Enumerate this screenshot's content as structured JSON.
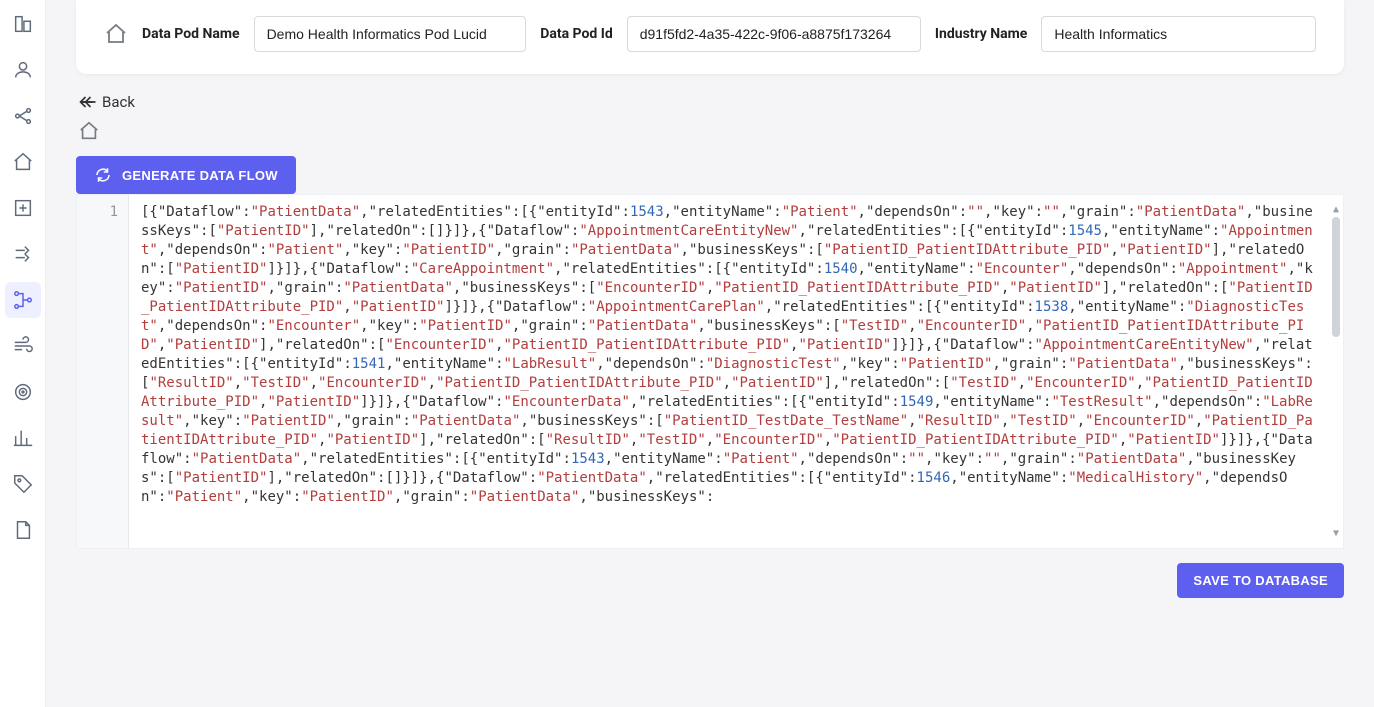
{
  "header": {
    "podNameLabel": "Data Pod Name",
    "podNameValue": "Demo Health Informatics Pod Lucid",
    "podIdLabel": "Data Pod Id",
    "podIdValue": "d91f5fd2-4a35-422c-9f06-a8875f173264",
    "industryLabel": "Industry Name",
    "industryValue": "Health Informatics"
  },
  "back": {
    "label": "Back"
  },
  "buttons": {
    "generate": "GENERATE DATA FLOW",
    "save": "SAVE TO DATABASE"
  },
  "editor": {
    "lineNumber": "1"
  },
  "sidebar_icons": [
    "org-icon",
    "user-icon",
    "nodes-icon",
    "home-icon",
    "export-icon",
    "flow-icon",
    "graph-icon",
    "wind-icon",
    "target-icon",
    "analytics-icon",
    "tag-icon",
    "doc-icon"
  ],
  "code_tokens": [
    [
      "p",
      "[{"
    ],
    [
      "k",
      "\"Dataflow\""
    ],
    [
      "p",
      ":"
    ],
    [
      "s",
      "\"PatientData\""
    ],
    [
      "p",
      ","
    ],
    [
      "k",
      "\"relatedEntities\""
    ],
    [
      "p",
      ":[{"
    ],
    [
      "k",
      "\"entityId\""
    ],
    [
      "p",
      ":"
    ],
    [
      "n",
      "1543"
    ],
    [
      "p",
      ","
    ],
    [
      "k",
      "\"entityName\""
    ],
    [
      "p",
      ":"
    ],
    [
      "s",
      "\"Patient\""
    ],
    [
      "p",
      ","
    ],
    [
      "k",
      "\"dependsOn\""
    ],
    [
      "p",
      ":"
    ],
    [
      "s",
      "\"\""
    ],
    [
      "p",
      ","
    ],
    [
      "k",
      "\"key\""
    ],
    [
      "p",
      ":"
    ],
    [
      "s",
      "\"\""
    ],
    [
      "p",
      ","
    ],
    [
      "k",
      "\"grain\""
    ],
    [
      "p",
      ":"
    ],
    [
      "s",
      "\"PatientData\""
    ],
    [
      "p",
      ","
    ],
    [
      "k",
      "\"businessKeys\""
    ],
    [
      "p",
      ":["
    ],
    [
      "s",
      "\"PatientID\""
    ],
    [
      "p",
      "],"
    ],
    [
      "k",
      "\"relatedOn\""
    ],
    [
      "p",
      ":[]}]},{"
    ],
    [
      "k",
      "\"Dataflow\""
    ],
    [
      "p",
      ":"
    ],
    [
      "s",
      "\"AppointmentCareEntityNew\""
    ],
    [
      "p",
      ","
    ],
    [
      "k",
      "\"relatedEntities\""
    ],
    [
      "p",
      ":[{"
    ],
    [
      "k",
      "\"entityId\""
    ],
    [
      "p",
      ":"
    ],
    [
      "n",
      "1545"
    ],
    [
      "p",
      ","
    ],
    [
      "k",
      "\"entityName\""
    ],
    [
      "p",
      ":"
    ],
    [
      "s",
      "\"Appointment\""
    ],
    [
      "p",
      ","
    ],
    [
      "k",
      "\"dependsOn\""
    ],
    [
      "p",
      ":"
    ],
    [
      "s",
      "\"Patient\""
    ],
    [
      "p",
      ","
    ],
    [
      "k",
      "\"key\""
    ],
    [
      "p",
      ":"
    ],
    [
      "s",
      "\"PatientID\""
    ],
    [
      "p",
      ","
    ],
    [
      "k",
      "\"grain\""
    ],
    [
      "p",
      ":"
    ],
    [
      "s",
      "\"PatientData\""
    ],
    [
      "p",
      ","
    ],
    [
      "k",
      "\"businessKeys\""
    ],
    [
      "p",
      ":["
    ],
    [
      "s",
      "\"PatientID_PatientIDAttribute_PID\""
    ],
    [
      "p",
      ","
    ],
    [
      "s",
      "\"PatientID\""
    ],
    [
      "p",
      "],"
    ],
    [
      "k",
      "\"relatedOn\""
    ],
    [
      "p",
      ":["
    ],
    [
      "s",
      "\"PatientID\""
    ],
    [
      "p",
      "]}]},{"
    ],
    [
      "k",
      "\"Dataflow\""
    ],
    [
      "p",
      ":"
    ],
    [
      "s",
      "\"CareAppointment\""
    ],
    [
      "p",
      ","
    ],
    [
      "k",
      "\"relatedEntities\""
    ],
    [
      "p",
      ":[{"
    ],
    [
      "k",
      "\"entityId\""
    ],
    [
      "p",
      ":"
    ],
    [
      "n",
      "1540"
    ],
    [
      "p",
      ","
    ],
    [
      "k",
      "\"entityName\""
    ],
    [
      "p",
      ":"
    ],
    [
      "s",
      "\"Encounter\""
    ],
    [
      "p",
      ","
    ],
    [
      "k",
      "\"dependsOn\""
    ],
    [
      "p",
      ":"
    ],
    [
      "s",
      "\"Appointment\""
    ],
    [
      "p",
      ","
    ],
    [
      "k",
      "\"key\""
    ],
    [
      "p",
      ":"
    ],
    [
      "s",
      "\"PatientID\""
    ],
    [
      "p",
      ","
    ],
    [
      "k",
      "\"grain\""
    ],
    [
      "p",
      ":"
    ],
    [
      "s",
      "\"PatientData\""
    ],
    [
      "p",
      ","
    ],
    [
      "k",
      "\"businessKeys\""
    ],
    [
      "p",
      ":["
    ],
    [
      "s",
      "\"EncounterID\""
    ],
    [
      "p",
      ","
    ],
    [
      "s",
      "\"PatientID_PatientIDAttribute_PID\""
    ],
    [
      "p",
      ","
    ],
    [
      "s",
      "\"PatientID\""
    ],
    [
      "p",
      "],"
    ],
    [
      "k",
      "\"relatedOn\""
    ],
    [
      "p",
      ":["
    ],
    [
      "s",
      "\"PatientID_PatientIDAttribute_PID\""
    ],
    [
      "p",
      ","
    ],
    [
      "s",
      "\"PatientID\""
    ],
    [
      "p",
      "]}]},{"
    ],
    [
      "k",
      "\"Dataflow\""
    ],
    [
      "p",
      ":"
    ],
    [
      "s",
      "\"AppointmentCarePlan\""
    ],
    [
      "p",
      ","
    ],
    [
      "k",
      "\"relatedEntities\""
    ],
    [
      "p",
      ":[{"
    ],
    [
      "k",
      "\"entityId\""
    ],
    [
      "p",
      ":"
    ],
    [
      "n",
      "1538"
    ],
    [
      "p",
      ","
    ],
    [
      "k",
      "\"entityName\""
    ],
    [
      "p",
      ":"
    ],
    [
      "s",
      "\"DiagnosticTest\""
    ],
    [
      "p",
      ","
    ],
    [
      "k",
      "\"dependsOn\""
    ],
    [
      "p",
      ":"
    ],
    [
      "s",
      "\"Encounter\""
    ],
    [
      "p",
      ","
    ],
    [
      "k",
      "\"key\""
    ],
    [
      "p",
      ":"
    ],
    [
      "s",
      "\"PatientID\""
    ],
    [
      "p",
      ","
    ],
    [
      "k",
      "\"grain\""
    ],
    [
      "p",
      ":"
    ],
    [
      "s",
      "\"PatientData\""
    ],
    [
      "p",
      ","
    ],
    [
      "k",
      "\"businessKeys\""
    ],
    [
      "p",
      ":["
    ],
    [
      "s",
      "\"TestID\""
    ],
    [
      "p",
      ","
    ],
    [
      "s",
      "\"EncounterID\""
    ],
    [
      "p",
      ","
    ],
    [
      "s",
      "\"PatientID_PatientIDAttribute_PID\""
    ],
    [
      "p",
      ","
    ],
    [
      "s",
      "\"PatientID\""
    ],
    [
      "p",
      "],"
    ],
    [
      "k",
      "\"relatedOn\""
    ],
    [
      "p",
      ":["
    ],
    [
      "s",
      "\"EncounterID\""
    ],
    [
      "p",
      ","
    ],
    [
      "s",
      "\"PatientID_PatientIDAttribute_PID\""
    ],
    [
      "p",
      ","
    ],
    [
      "s",
      "\"PatientID\""
    ],
    [
      "p",
      "]}]},{"
    ],
    [
      "k",
      "\"Dataflow\""
    ],
    [
      "p",
      ":"
    ],
    [
      "s",
      "\"AppointmentCareEntityNew\""
    ],
    [
      "p",
      ","
    ],
    [
      "k",
      "\"relatedEntities\""
    ],
    [
      "p",
      ":[{"
    ],
    [
      "k",
      "\"entityId\""
    ],
    [
      "p",
      ":"
    ],
    [
      "n",
      "1541"
    ],
    [
      "p",
      ","
    ],
    [
      "k",
      "\"entityName\""
    ],
    [
      "p",
      ":"
    ],
    [
      "s",
      "\"LabResult\""
    ],
    [
      "p",
      ","
    ],
    [
      "k",
      "\"dependsOn\""
    ],
    [
      "p",
      ":"
    ],
    [
      "s",
      "\"DiagnosticTest\""
    ],
    [
      "p",
      ","
    ],
    [
      "k",
      "\"key\""
    ],
    [
      "p",
      ":"
    ],
    [
      "s",
      "\"PatientID\""
    ],
    [
      "p",
      ","
    ],
    [
      "k",
      "\"grain\""
    ],
    [
      "p",
      ":"
    ],
    [
      "s",
      "\"PatientData\""
    ],
    [
      "p",
      ","
    ],
    [
      "k",
      "\"businessKeys\""
    ],
    [
      "p",
      ":["
    ],
    [
      "s",
      "\"ResultID\""
    ],
    [
      "p",
      ","
    ],
    [
      "s",
      "\"TestID\""
    ],
    [
      "p",
      ","
    ],
    [
      "s",
      "\"EncounterID\""
    ],
    [
      "p",
      ","
    ],
    [
      "s",
      "\"PatientID_PatientIDAttribute_PID\""
    ],
    [
      "p",
      ","
    ],
    [
      "s",
      "\"PatientID\""
    ],
    [
      "p",
      "],"
    ],
    [
      "k",
      "\"relatedOn\""
    ],
    [
      "p",
      ":["
    ],
    [
      "s",
      "\"TestID\""
    ],
    [
      "p",
      ","
    ],
    [
      "s",
      "\"EncounterID\""
    ],
    [
      "p",
      ","
    ],
    [
      "s",
      "\"PatientID_PatientIDAttribute_PID\""
    ],
    [
      "p",
      ","
    ],
    [
      "s",
      "\"PatientID\""
    ],
    [
      "p",
      "]}]},{"
    ],
    [
      "k",
      "\"Dataflow\""
    ],
    [
      "p",
      ":"
    ],
    [
      "s",
      "\"EncounterData\""
    ],
    [
      "p",
      ","
    ],
    [
      "k",
      "\"relatedEntities\""
    ],
    [
      "p",
      ":[{"
    ],
    [
      "k",
      "\"entityId\""
    ],
    [
      "p",
      ":"
    ],
    [
      "n",
      "1549"
    ],
    [
      "p",
      ","
    ],
    [
      "k",
      "\"entityName\""
    ],
    [
      "p",
      ":"
    ],
    [
      "s",
      "\"TestResult\""
    ],
    [
      "p",
      ","
    ],
    [
      "k",
      "\"dependsOn\""
    ],
    [
      "p",
      ":"
    ],
    [
      "s",
      "\"LabResult\""
    ],
    [
      "p",
      ","
    ],
    [
      "k",
      "\"key\""
    ],
    [
      "p",
      ":"
    ],
    [
      "s",
      "\"PatientID\""
    ],
    [
      "p",
      ","
    ],
    [
      "k",
      "\"grain\""
    ],
    [
      "p",
      ":"
    ],
    [
      "s",
      "\"PatientData\""
    ],
    [
      "p",
      ","
    ],
    [
      "k",
      "\"businessKeys\""
    ],
    [
      "p",
      ":["
    ],
    [
      "s",
      "\"PatientID_TestDate_TestName\""
    ],
    [
      "p",
      ","
    ],
    [
      "s",
      "\"ResultID\""
    ],
    [
      "p",
      ","
    ],
    [
      "s",
      "\"TestID\""
    ],
    [
      "p",
      ","
    ],
    [
      "s",
      "\"EncounterID\""
    ],
    [
      "p",
      ","
    ],
    [
      "s",
      "\"PatientID_PatientIDAttribute_PID\""
    ],
    [
      "p",
      ","
    ],
    [
      "s",
      "\"PatientID\""
    ],
    [
      "p",
      "],"
    ],
    [
      "k",
      "\"relatedOn\""
    ],
    [
      "p",
      ":["
    ],
    [
      "s",
      "\"ResultID\""
    ],
    [
      "p",
      ","
    ],
    [
      "s",
      "\"TestID\""
    ],
    [
      "p",
      ","
    ],
    [
      "s",
      "\"EncounterID\""
    ],
    [
      "p",
      ","
    ],
    [
      "s",
      "\"PatientID_PatientIDAttribute_PID\""
    ],
    [
      "p",
      ","
    ],
    [
      "s",
      "\"PatientID\""
    ],
    [
      "p",
      "]}]},{"
    ],
    [
      "k",
      "\"Dataflow\""
    ],
    [
      "p",
      ":"
    ],
    [
      "s",
      "\"PatientData\""
    ],
    [
      "p",
      ","
    ],
    [
      "k",
      "\"relatedEntities\""
    ],
    [
      "p",
      ":[{"
    ],
    [
      "k",
      "\"entityId\""
    ],
    [
      "p",
      ":"
    ],
    [
      "n",
      "1543"
    ],
    [
      "p",
      ","
    ],
    [
      "k",
      "\"entityName\""
    ],
    [
      "p",
      ":"
    ],
    [
      "s",
      "\"Patient\""
    ],
    [
      "p",
      ","
    ],
    [
      "k",
      "\"dependsOn\""
    ],
    [
      "p",
      ":"
    ],
    [
      "s",
      "\"\""
    ],
    [
      "p",
      ","
    ],
    [
      "k",
      "\"key\""
    ],
    [
      "p",
      ":"
    ],
    [
      "s",
      "\"\""
    ],
    [
      "p",
      ","
    ],
    [
      "k",
      "\"grain\""
    ],
    [
      "p",
      ":"
    ],
    [
      "s",
      "\"PatientData\""
    ],
    [
      "p",
      ","
    ],
    [
      "k",
      "\"businessKeys\""
    ],
    [
      "p",
      ":["
    ],
    [
      "s",
      "\"PatientID\""
    ],
    [
      "p",
      "],"
    ],
    [
      "k",
      "\"relatedOn\""
    ],
    [
      "p",
      ":[]}]},{"
    ],
    [
      "k",
      "\"Dataflow\""
    ],
    [
      "p",
      ":"
    ],
    [
      "s",
      "\"PatientData\""
    ],
    [
      "p",
      ","
    ],
    [
      "k",
      "\"relatedEntities\""
    ],
    [
      "p",
      ":[{"
    ],
    [
      "k",
      "\"entityId\""
    ],
    [
      "p",
      ":"
    ],
    [
      "n",
      "1546"
    ],
    [
      "p",
      ","
    ],
    [
      "k",
      "\"entityName\""
    ],
    [
      "p",
      ":"
    ],
    [
      "s",
      "\"MedicalHistory\""
    ],
    [
      "p",
      ","
    ],
    [
      "k",
      "\"dependsOn\""
    ],
    [
      "p",
      ":"
    ],
    [
      "s",
      "\"Patient\""
    ],
    [
      "p",
      ","
    ],
    [
      "k",
      "\"key\""
    ],
    [
      "p",
      ":"
    ],
    [
      "s",
      "\"PatientID\""
    ],
    [
      "p",
      ","
    ],
    [
      "k",
      "\"grain\""
    ],
    [
      "p",
      ":"
    ],
    [
      "s",
      "\"PatientData\""
    ],
    [
      "p",
      ","
    ],
    [
      "k",
      "\"businessKeys\""
    ],
    [
      "p",
      ":"
    ]
  ],
  "dataflow_payload": [
    {
      "Dataflow": "PatientData",
      "relatedEntities": [
        {
          "entityId": 1543,
          "entityName": "Patient",
          "dependsOn": "",
          "key": "",
          "grain": "PatientData",
          "businessKeys": [
            "PatientID"
          ],
          "relatedOn": []
        }
      ]
    },
    {
      "Dataflow": "AppointmentCareEntityNew",
      "relatedEntities": [
        {
          "entityId": 1545,
          "entityName": "Appointment",
          "dependsOn": "Patient",
          "key": "PatientID",
          "grain": "PatientData",
          "businessKeys": [
            "PatientID_PatientIDAttribute_PID",
            "PatientID"
          ],
          "relatedOn": [
            "PatientID"
          ]
        }
      ]
    },
    {
      "Dataflow": "CareAppointment",
      "relatedEntities": [
        {
          "entityId": 1540,
          "entityName": "Encounter",
          "dependsOn": "Appointment",
          "key": "PatientID",
          "grain": "PatientData",
          "businessKeys": [
            "EncounterID",
            "PatientID_PatientIDAttribute_PID",
            "PatientID"
          ],
          "relatedOn": [
            "PatientID_PatientIDAttribute_PID",
            "PatientID"
          ]
        }
      ]
    },
    {
      "Dataflow": "AppointmentCarePlan",
      "relatedEntities": [
        {
          "entityId": 1538,
          "entityName": "DiagnosticTest",
          "dependsOn": "Encounter",
          "key": "PatientID",
          "grain": "PatientData",
          "businessKeys": [
            "TestID",
            "EncounterID",
            "PatientID_PatientIDAttribute_PID",
            "PatientID"
          ],
          "relatedOn": [
            "EncounterID",
            "PatientID_PatientIDAttribute_PID",
            "PatientID"
          ]
        }
      ]
    },
    {
      "Dataflow": "AppointmentCareEntityNew",
      "relatedEntities": [
        {
          "entityId": 1541,
          "entityName": "LabResult",
          "dependsOn": "DiagnosticTest",
          "key": "PatientID",
          "grain": "PatientData",
          "businessKeys": [
            "ResultID",
            "TestID",
            "EncounterID",
            "PatientID_PatientIDAttribute_PID",
            "PatientID"
          ],
          "relatedOn": [
            "TestID",
            "EncounterID",
            "PatientID_PatientIDAttribute_PID",
            "PatientID"
          ]
        }
      ]
    },
    {
      "Dataflow": "EncounterData",
      "relatedEntities": [
        {
          "entityId": 1549,
          "entityName": "TestResult",
          "dependsOn": "LabResult",
          "key": "PatientID",
          "grain": "PatientData",
          "businessKeys": [
            "PatientID_TestDate_TestName",
            "ResultID",
            "TestID",
            "EncounterID",
            "PatientID_PatientIDAttribute_PID",
            "PatientID"
          ],
          "relatedOn": [
            "ResultID",
            "TestID",
            "EncounterID",
            "PatientID_PatientIDAttribute_PID",
            "PatientID"
          ]
        }
      ]
    },
    {
      "Dataflow": "PatientData",
      "relatedEntities": [
        {
          "entityId": 1543,
          "entityName": "Patient",
          "dependsOn": "",
          "key": "",
          "grain": "PatientData",
          "businessKeys": [
            "PatientID"
          ],
          "relatedOn": []
        }
      ]
    },
    {
      "Dataflow": "PatientData",
      "relatedEntities": [
        {
          "entityId": 1546,
          "entityName": "MedicalHistory",
          "dependsOn": "Patient",
          "key": "PatientID",
          "grain": "PatientData",
          "businessKeys": []
        }
      ]
    }
  ]
}
